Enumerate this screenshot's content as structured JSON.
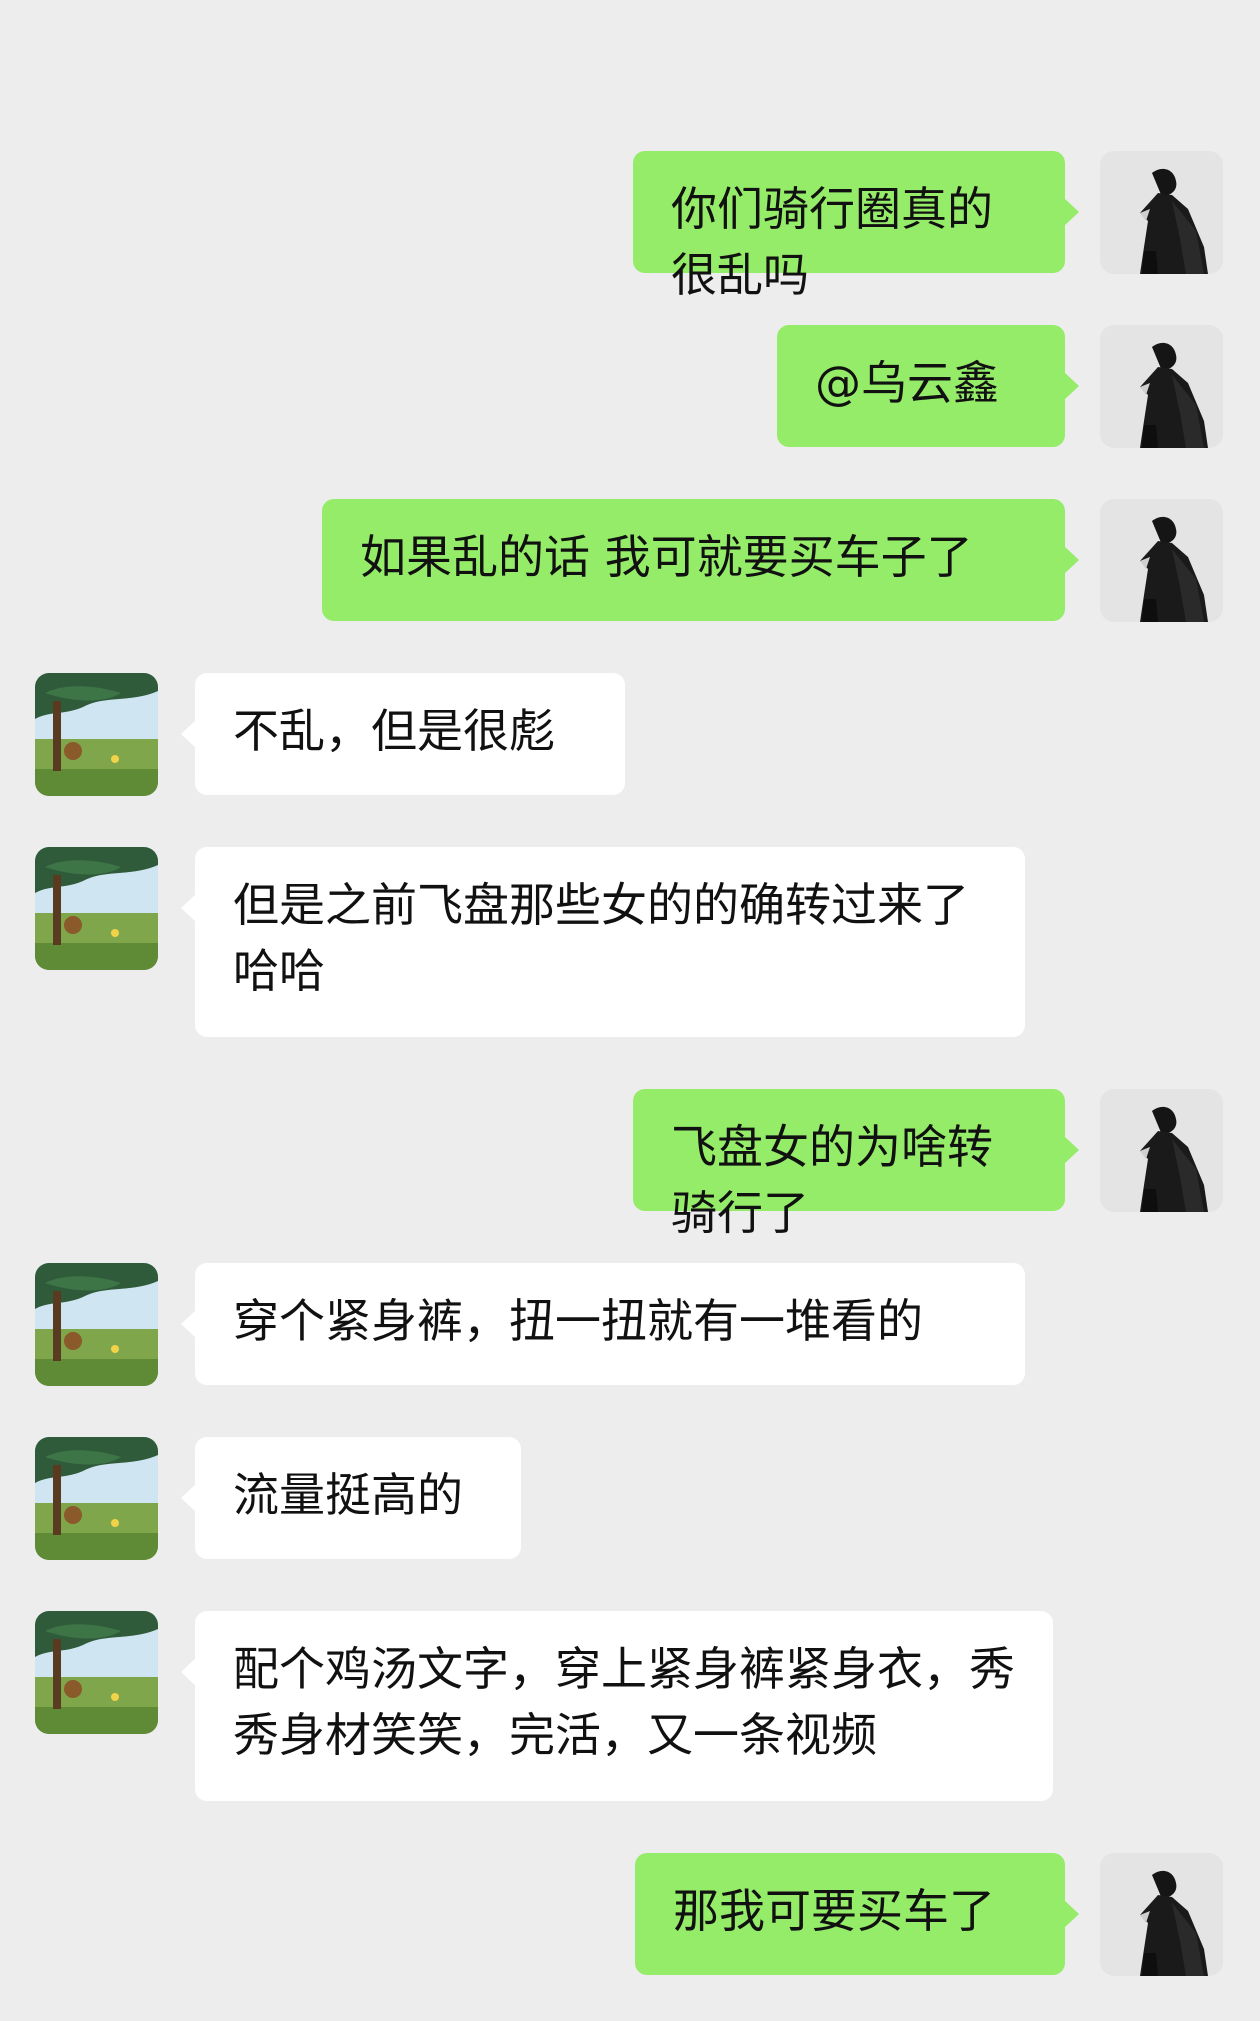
{
  "colors": {
    "background": "#ededed",
    "self_bubble": "#95ec69",
    "other_bubble": "#ffffff",
    "text": "#111111"
  },
  "avatars": {
    "self": "dark-cloaked-figure-avatar",
    "other": "anime-landscape-tree-avatar"
  },
  "messages": [
    {
      "sender": "self",
      "text": "你们骑行圈真的很乱吗"
    },
    {
      "sender": "self",
      "text": "@乌云鑫"
    },
    {
      "sender": "self",
      "text": "如果乱的话 我可就要买车子了"
    },
    {
      "sender": "other",
      "text": "不乱，但是很彪"
    },
    {
      "sender": "other",
      "text": "但是之前飞盘那些女的的确转过来了哈哈"
    },
    {
      "sender": "self",
      "text": "飞盘女的为啥转骑行了"
    },
    {
      "sender": "other",
      "text": "穿个紧身裤，扭一扭就有一堆看的"
    },
    {
      "sender": "other",
      "text": "流量挺高的"
    },
    {
      "sender": "other",
      "text": "配个鸡汤文字，穿上紧身裤紧身衣，秀秀身材笑笑，完活，又一条视频"
    },
    {
      "sender": "self",
      "text": "那我可要买车了"
    }
  ]
}
